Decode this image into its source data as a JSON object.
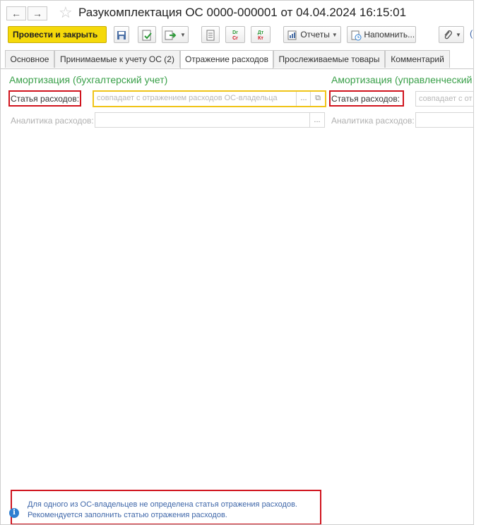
{
  "window": {
    "title": "Разукомплектация ОС 0000-000001 от 04.04.2024 16:15:01",
    "back_glyph": "←",
    "forward_glyph": "→",
    "star_glyph": "☆"
  },
  "toolbar": {
    "post_close": "Провести и закрыть",
    "reports": "Отчеты",
    "remind": "Напомнить...",
    "dr_top": "Dr",
    "dr_bottom": "Cr",
    "at_top": "Дт",
    "at_bottom": "Кт",
    "link_fragment": "("
  },
  "tabs": [
    {
      "label": "Основное",
      "active": false
    },
    {
      "label": "Принимаемые к учету ОС (2)",
      "active": false
    },
    {
      "label": "Отражение расходов",
      "active": true
    },
    {
      "label": "Прослеживаемые товары",
      "active": false
    },
    {
      "label": "Комментарий",
      "active": false
    }
  ],
  "left": {
    "section": "Амортизация (бухгалтерский учет)",
    "expense_label": "Статья расходов:",
    "expense_placeholder": "совпадает с отражением расходов ОС-владельца",
    "analytics_label": "Аналитика расходов:"
  },
  "right": {
    "section": "Амортизация (управленческий",
    "expense_label": "Статья расходов:",
    "expense_placeholder": "совпадает с от",
    "analytics_label": "Аналитика расходов:"
  },
  "field_buttons": {
    "more": "...",
    "open": "⧉"
  },
  "message": {
    "line1": "Для одного из ОС-владельцев не определена статья отражения расходов.",
    "line2": "Рекомендуется заполнить статью отражения расходов.",
    "icon": "i"
  },
  "colors": {
    "accent_green": "#3aa04a",
    "primary_yellow": "#f5d90a",
    "error_red": "#d0141e",
    "message_blue": "#3f67a9"
  }
}
